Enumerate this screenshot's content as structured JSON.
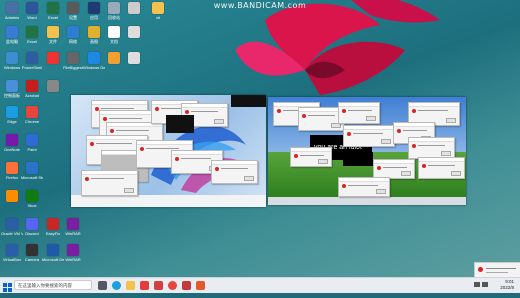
{
  "watermark": "www.BANDICAM.com",
  "taskbar": {
    "search_placeholder": "在这里输入你要搜索的内容",
    "time": "9:01",
    "date": "2022/8"
  },
  "vm_text": "you are an idiot",
  "colors": {
    "wallpaper": "#1f6b79",
    "taskbar": "#e9ecf1",
    "accent": "#0a64c8",
    "flower": "#d9154b"
  },
  "desktop_icons": [
    {
      "label": "Adminis"
    },
    {
      "label": "Word"
    },
    {
      "label": "Excel"
    },
    {
      "label": "设置"
    },
    {
      "label": "应用"
    },
    {
      "label": "回收站"
    },
    {
      "label": ""
    },
    {
      "label": "xit"
    },
    {
      "label": "此电脑"
    },
    {
      "label": "Excel"
    },
    {
      "label": "文件"
    },
    {
      "label": "网络"
    },
    {
      "label": "画图"
    },
    {
      "label": "文档"
    },
    {
      "label": ""
    },
    {
      "label": "Windows"
    },
    {
      "label": "PowerShell"
    },
    {
      "label": ""
    },
    {
      "label": "FileBiggest"
    },
    {
      "label": "Windows Defender"
    },
    {
      "label": ""
    },
    {
      "label": ""
    },
    {
      "label": "控制面板"
    },
    {
      "label": "Acrobat"
    },
    {
      "label": ""
    },
    {
      "label": "Edge"
    },
    {
      "label": "Chrome"
    },
    {
      "label": "OneNote"
    },
    {
      "label": "Paint"
    },
    {
      "label": "Firefox"
    },
    {
      "label": "Microsoft Store"
    },
    {
      "label": ""
    },
    {
      "label": "Xbox"
    },
    {
      "label": "Oracle VM VirtualBox"
    },
    {
      "label": "Discord"
    },
    {
      "label": "EasyFix"
    },
    {
      "label": "WinRAR"
    },
    {
      "label": "VirtualBox"
    },
    {
      "label": "Camera"
    },
    {
      "label": "Microsoft Defender"
    },
    {
      "label": "WinRAR"
    }
  ]
}
